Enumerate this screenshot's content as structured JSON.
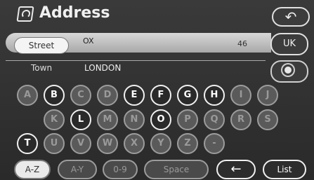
{
  "header": {
    "title": "Address",
    "back_symbol": "↶",
    "icon": "address-book-icon"
  },
  "street_row": {
    "label": "Street",
    "value": "OX",
    "count": "46",
    "country_button": "UK"
  },
  "town_row": {
    "label": "Town",
    "value": "LONDON",
    "target_icon": "target-icon"
  },
  "keyboard": {
    "row1": [
      {
        "letter": "A",
        "active": false
      },
      {
        "letter": "B",
        "active": true
      },
      {
        "letter": "C",
        "active": false
      },
      {
        "letter": "D",
        "active": false
      },
      {
        "letter": "E",
        "active": true
      },
      {
        "letter": "F",
        "active": true
      },
      {
        "letter": "G",
        "active": true
      },
      {
        "letter": "H",
        "active": true
      },
      {
        "letter": "I",
        "active": false
      },
      {
        "letter": "J",
        "active": false
      }
    ],
    "row2": [
      {
        "letter": "K",
        "active": false
      },
      {
        "letter": "L",
        "active": true
      },
      {
        "letter": "M",
        "active": false
      },
      {
        "letter": "N",
        "active": false
      },
      {
        "letter": "O",
        "active": true
      },
      {
        "letter": "P",
        "active": false
      },
      {
        "letter": "Q",
        "active": false
      },
      {
        "letter": "R",
        "active": false
      },
      {
        "letter": "S",
        "active": false
      }
    ],
    "row3": [
      {
        "letter": "T",
        "active": true
      },
      {
        "letter": "U",
        "active": false
      },
      {
        "letter": "V",
        "active": false
      },
      {
        "letter": "W",
        "active": false
      },
      {
        "letter": "X",
        "active": false
      },
      {
        "letter": "Y",
        "active": false
      },
      {
        "letter": "Z",
        "active": false
      },
      {
        "letter": "-",
        "active": false
      }
    ]
  },
  "bottom": {
    "az": "A-Z",
    "ay": "A-Y",
    "num": "0-9",
    "space": "Space",
    "backspace": "←",
    "list": "List"
  }
}
